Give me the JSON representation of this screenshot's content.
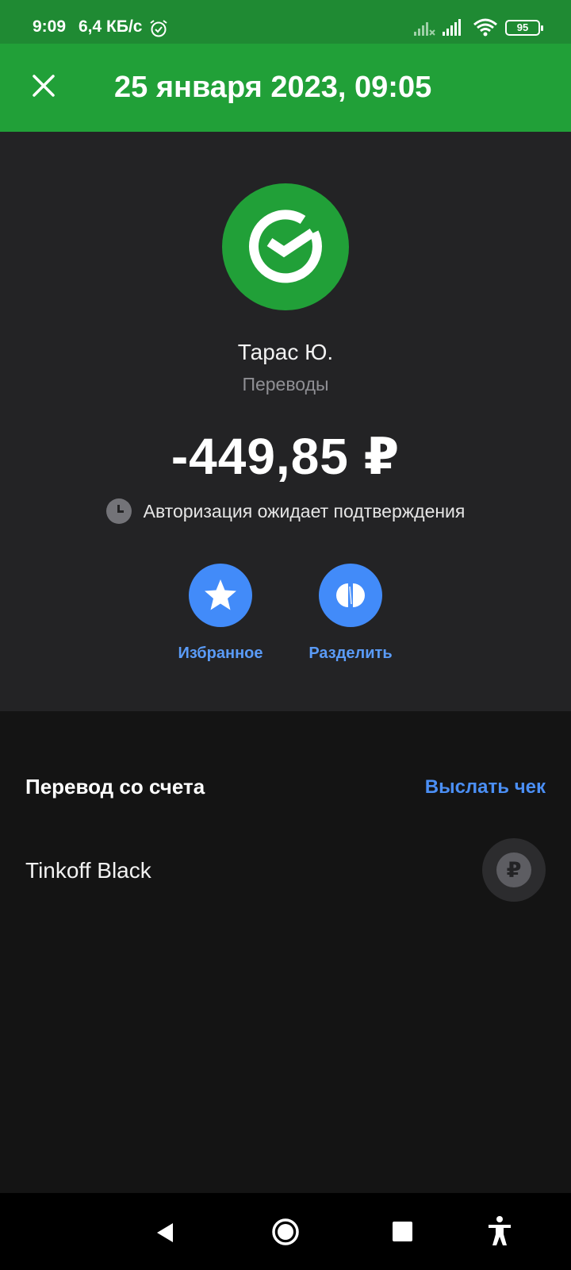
{
  "status_bar": {
    "time": "9:09",
    "speed": "6,4 КБ/с",
    "battery": "95",
    "icons": [
      "alarm-icon",
      "signal-sim1-icon",
      "signal-sim2-icon",
      "wifi-icon",
      "battery-icon"
    ]
  },
  "header": {
    "title": "25 января 2023, 09:05",
    "close_icon": "close-icon",
    "background": "#21a038"
  },
  "transaction": {
    "merchant": "Тарас Ю.",
    "category": "Переводы",
    "amount": "-449,85 ₽",
    "status": "Авторизация ожидает подтверждения",
    "logo_icon": "sber-logo-icon",
    "logo_color": "#21a038"
  },
  "actions": {
    "favorite_label": "Избранное",
    "split_label": "Разделить",
    "accent": "#428bf9"
  },
  "account_section": {
    "title": "Перевод со счета",
    "send_receipt": "Выслать чек",
    "account_name": "Tinkoff Black",
    "currency_symbol": "₽"
  },
  "nav_bar": {
    "icons": [
      "back-icon",
      "home-icon",
      "recents-icon",
      "accessibility-icon"
    ]
  }
}
